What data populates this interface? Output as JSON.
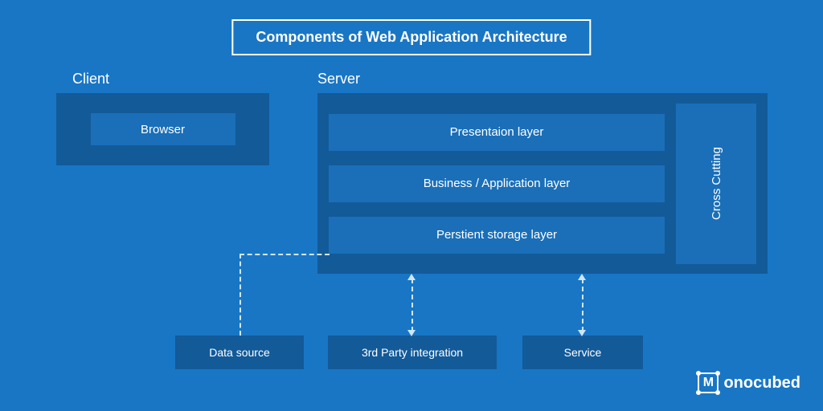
{
  "title": "Components of Web Application Architecture",
  "sections": {
    "client_label": "Client",
    "server_label": "Server"
  },
  "client": {
    "browser": "Browser"
  },
  "server": {
    "layers": {
      "presentation": "Presentaion layer",
      "business": "Business / Application layer",
      "storage": "Perstient storage layer"
    },
    "cross_cutting": "Cross  Cutting"
  },
  "bottom": {
    "data_source": "Data source",
    "third_party": "3rd Party integration",
    "service": "Service"
  },
  "brand": {
    "mark_letter": "M",
    "name": "onocubed"
  },
  "colors": {
    "bg": "#1976c5",
    "block_dark": "#135a99",
    "block_mid": "#1a6fb8",
    "line": "#cfe6f7",
    "text": "#ffffff"
  }
}
